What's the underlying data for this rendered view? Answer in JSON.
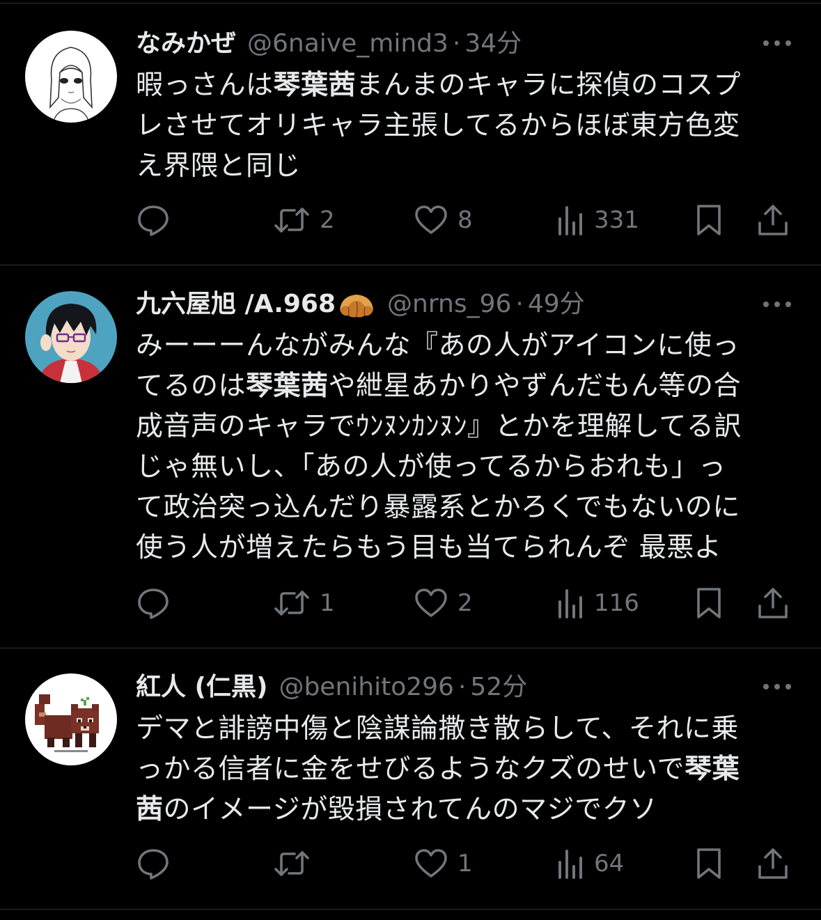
{
  "colors": {
    "background": "#000000",
    "primary_text": "#e7e9ea",
    "secondary_text": "#71767b",
    "divider": "#2f3336"
  },
  "tweets": [
    {
      "name": "なみかぜ",
      "handle": "@6naive_mind3",
      "separator": "·",
      "time": "34分",
      "avatar_icon": "anime-girl-sketch-avatar",
      "body_lines": [
        [
          "暇っさんは",
          "琴葉茜",
          "まんまのキャラに探偵のコスプ"
        ],
        [
          "レさせてオリキャラ主張してるからほぼ東方色変"
        ],
        [
          "え界隈と同じ"
        ]
      ],
      "replies": "",
      "retweets": "2",
      "likes": "8",
      "views": "331"
    },
    {
      "name": "九六屋旭 /A.968",
      "name_emoji": "croissant-emoji",
      "handle": "@nrns_96",
      "separator": "·",
      "time": "49分",
      "avatar_icon": "anime-boy-glasses-avatar",
      "body_lines": [
        [
          "みーーーんながみんな『あの人がアイコンに使っ"
        ],
        [
          "てるのは",
          "琴葉茜",
          "や紲星あかりやずんだもん等の合"
        ],
        [
          "成音声のキャラでｳﾝﾇﾝｶﾝﾇﾝ』とかを理解してる訳"
        ],
        [
          "じゃ無いし、「あの人が使ってるからおれも」っ"
        ],
        [
          "て政治突っ込んだり暴露系とかろくでもないのに"
        ],
        [
          "使う人が増えたらもう目も当てられんぞ 最悪よ"
        ]
      ],
      "replies": "",
      "retweets": "1",
      "likes": "2",
      "views": "116"
    },
    {
      "name": "紅人 (仁黒)",
      "handle": "@benihito296",
      "separator": "·",
      "time": "52分",
      "avatar_icon": "pixel-red-panda-avatar",
      "body_lines": [
        [
          "デマと誹謗中傷と陰謀論撒き散らして、それに乗"
        ],
        [
          "っかる信者に金をせびるようなクズのせいで",
          "琴葉"
        ],
        [
          "茜",
          "のイメージが毀損されてんのマジでクソ"
        ]
      ],
      "replies": "",
      "retweets": "",
      "likes": "1",
      "views": "64"
    }
  ]
}
